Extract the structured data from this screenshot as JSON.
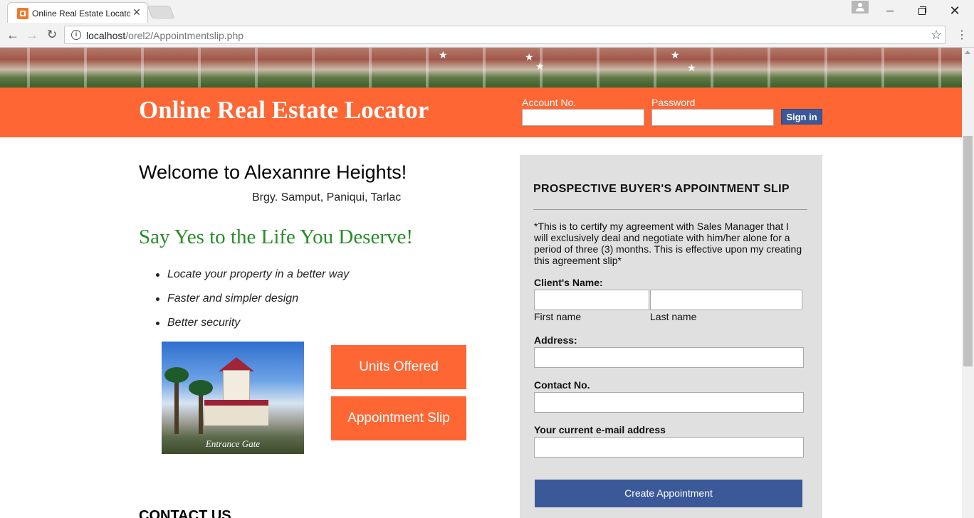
{
  "browser": {
    "tab_title": "Online Real Estate Locato",
    "url_host": "localhost",
    "url_path": "/orel2/Appointmentslip.php",
    "close_glyph": "✕"
  },
  "header": {
    "site_title": "Online Real Estate Locator",
    "account_label": "Account No.",
    "password_label": "Password",
    "signin_label": "Sign in",
    "accent_color": "#fe6634",
    "button_color": "#3b5999"
  },
  "main": {
    "welcome": "Welcome to Alexannre Heights!",
    "location": "Brgy. Samput, Paniqui, Tarlac",
    "tagline": "Say Yes to the Life You Deserve!",
    "features": [
      "Locate your property in a better way",
      "Faster and simpler design",
      "Better security"
    ],
    "image_caption": "Entrance Gate",
    "units_button": "Units Offered",
    "appointment_button": "Appointment Slip",
    "contact_heading": "CONTACT US"
  },
  "appointment": {
    "title": "PROSPECTIVE BUYER'S APPOINTMENT SLIP",
    "note": "*This is to certify my agreement with Sales Manager that I will exclusively deal and negotiate with him/her alone for a period of three (3) months. This is effective upon my creating this agreement slip*",
    "client_name_label": "Client's Name:",
    "first_name_label": "First name",
    "last_name_label": "Last name",
    "address_label": "Address:",
    "contact_label": "Contact No.",
    "email_label": "Your current e-mail address",
    "submit_label": "Create Appointment"
  }
}
